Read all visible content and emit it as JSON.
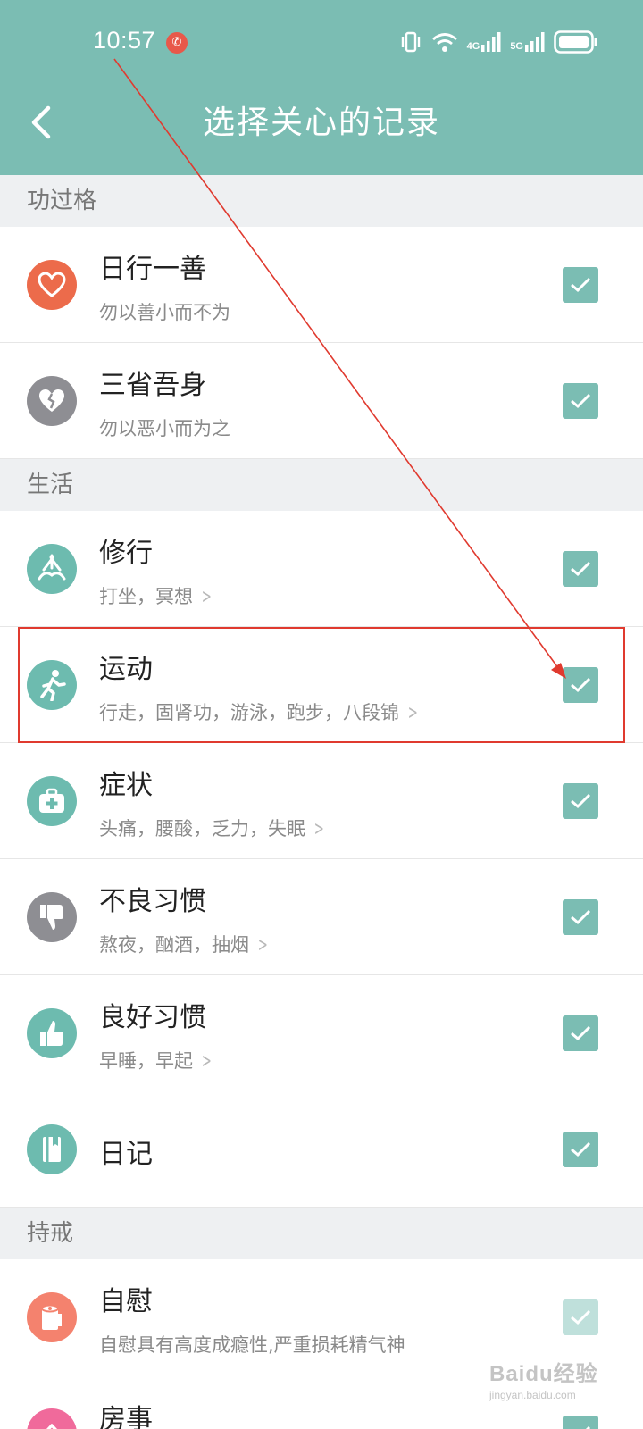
{
  "status_bar": {
    "time": "10:57",
    "net1": "4G",
    "net2": "5G"
  },
  "header": {
    "title": "选择关心的记录",
    "background": "#7bbdb3"
  },
  "sections": [
    {
      "title": "功过格",
      "items": [
        {
          "icon": "heart-icon",
          "title": "日行一善",
          "subtitle": "勿以善小而不为",
          "checked": true,
          "has_chevron": false
        },
        {
          "icon": "broken-heart-icon",
          "title": "三省吾身",
          "subtitle": "勿以恶小而为之",
          "checked": true,
          "has_chevron": false
        }
      ]
    },
    {
      "title": "生活",
      "items": [
        {
          "icon": "meditation-icon",
          "title": "修行",
          "subtitle": "打坐，冥想",
          "checked": true,
          "has_chevron": true
        },
        {
          "icon": "running-icon",
          "title": "运动",
          "subtitle": "行走，固肾功，游泳，跑步，八段锦",
          "checked": true,
          "has_chevron": true
        },
        {
          "icon": "medical-kit-icon",
          "title": "症状",
          "subtitle": "头痛，腰酸，乏力，失眠",
          "checked": true,
          "has_chevron": true
        },
        {
          "icon": "thumbs-down-icon",
          "title": "不良习惯",
          "subtitle": "熬夜，酗酒，抽烟",
          "checked": true,
          "has_chevron": true
        },
        {
          "icon": "thumbs-up-icon",
          "title": "良好习惯",
          "subtitle": "早睡，早起",
          "checked": true,
          "has_chevron": true
        },
        {
          "icon": "diary-icon",
          "title": "日记",
          "subtitle": "",
          "checked": true,
          "has_chevron": false
        }
      ]
    },
    {
      "title": "持戒",
      "items": [
        {
          "icon": "tissue-roll-icon",
          "title": "自慰",
          "subtitle": "自慰具有高度成瘾性,严重损耗精气神",
          "checked": true,
          "has_chevron": false
        },
        {
          "icon": "flower-icon",
          "title": "房事",
          "subtitle": "",
          "checked": true,
          "has_chevron": false
        }
      ]
    }
  ],
  "watermark": {
    "main": "Baidu经验",
    "sub": "jingyan.baidu.com"
  },
  "colors": {
    "accent": "#7bbdb3",
    "annotation_red": "#e03a2f",
    "icon_orange": "#ec6b4b",
    "icon_gray": "#8e8e93",
    "icon_teal": "#6dbbaf",
    "icon_salmon": "#f4826e",
    "icon_pink": "#f06a9b"
  }
}
